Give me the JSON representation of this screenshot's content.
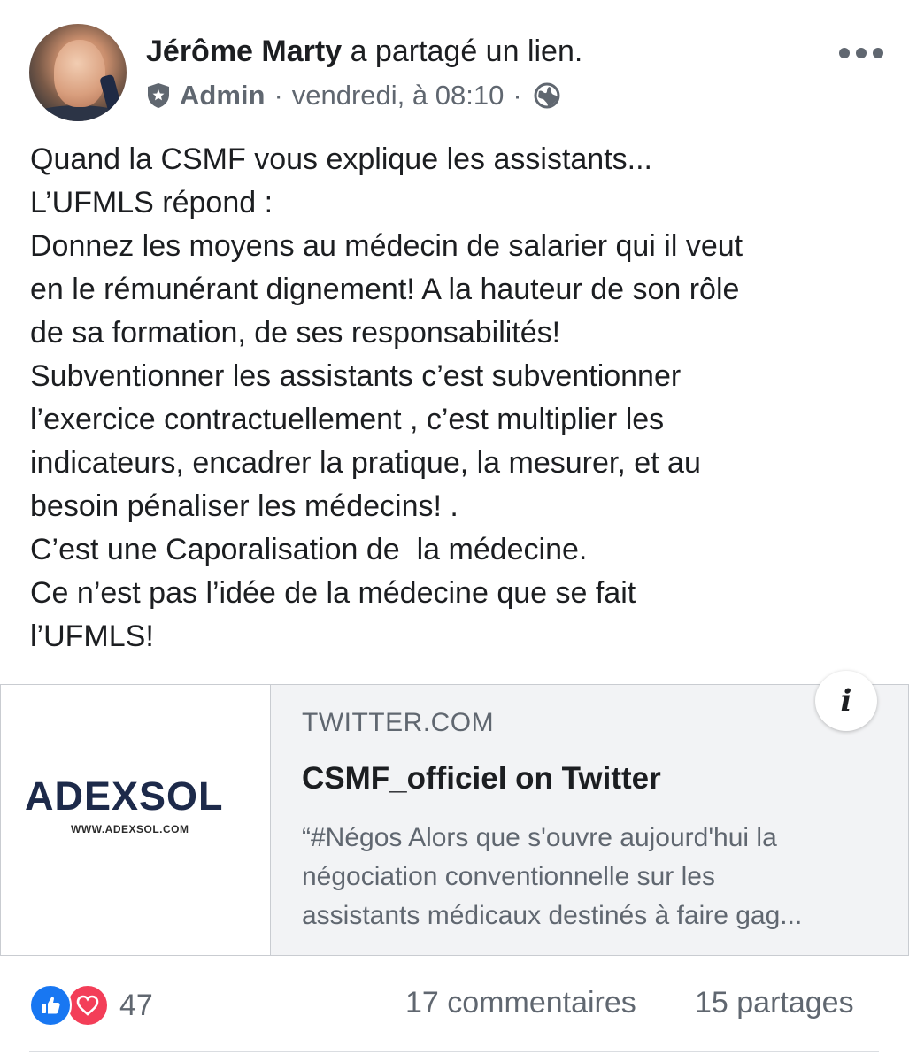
{
  "post": {
    "author": "Jérôme Marty",
    "action": "a partagé un lien.",
    "role": "Admin",
    "separator": "·",
    "timestamp": "vendredi, à 08:10",
    "privacy_icon": "globe-icon",
    "role_icon": "admin-shield-icon",
    "more_icon": "more-options-icon",
    "body_lines": [
      "Quand la CSMF vous explique les assistants...",
      "L’UFMLS répond :",
      "Donnez les moyens au médecin de salarier qui il veut",
      "en le rémunérant dignement! A la hauteur de son rôle",
      "de sa formation, de ses responsabilités!",
      "Subventionner les assistants c’est subventionner",
      "l’exercice contractuellement , c’est multiplier les",
      "indicateurs, encadrer la pratique, la mesurer, et au",
      "besoin pénaliser les médecins! .",
      "C’est une Caporalisation de  la médecine.",
      "Ce n’est pas l’idée de la médecine que se fait",
      "l’UFMLS!"
    ]
  },
  "link_card": {
    "logo_text": "ADEXSOL",
    "logo_url_text": "WWW.ADEXSOL.COM",
    "info_icon_glyph": "i",
    "domain": "TWITTER.COM",
    "title": "CSMF_officiel on Twitter",
    "description_lines": [
      "“#Négos Alors que s'ouvre aujourd'hui la",
      "négociation conventionnelle sur les",
      "assistants médicaux destinés à faire gag..."
    ]
  },
  "engagement": {
    "reaction_count": "47",
    "comments": "17 commentaires",
    "shares": "15 partages",
    "reaction_icons": [
      "like-icon",
      "love-icon"
    ]
  },
  "colors": {
    "text": "#1c1e21",
    "secondary": "#606770",
    "like": "#1877f2",
    "love": "#f33e58",
    "card_bg": "#f2f3f5"
  }
}
